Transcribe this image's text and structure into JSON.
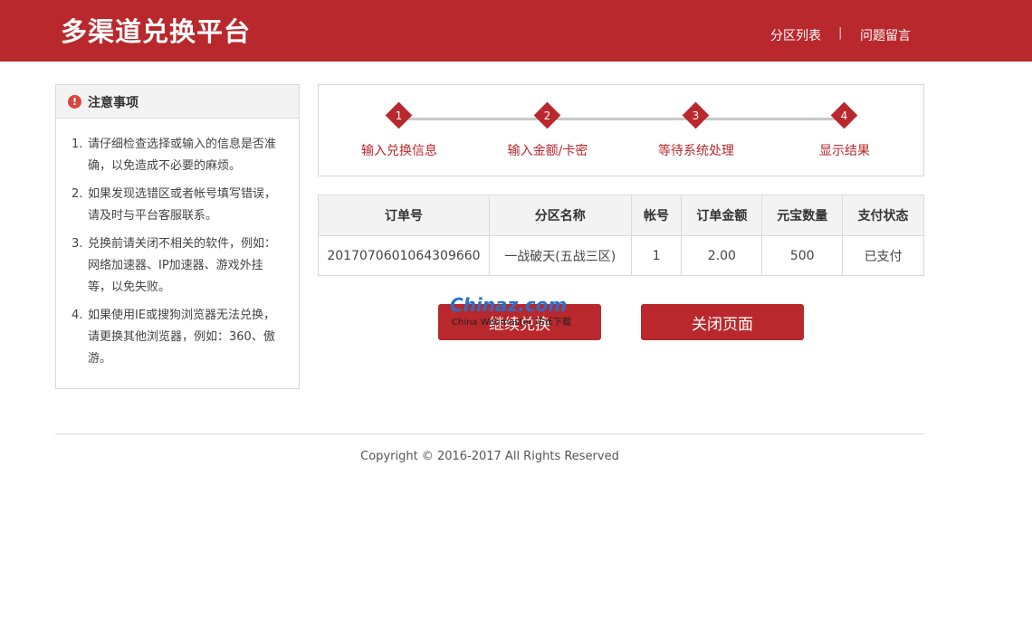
{
  "header": {
    "logo": "多渠道兑换平台",
    "nav": [
      "分区列表",
      "问题留言"
    ],
    "separator": "|"
  },
  "notice": {
    "icon": "alert-icon",
    "title": "注意事项",
    "items": [
      {
        "num": "1.",
        "text": "请仔细检查选择或输入的信息是否准确，以免造成不必要的麻烦。"
      },
      {
        "num": "2.",
        "text": "如果发现选错区或者帐号填写错误，请及时与平台客服联系。"
      },
      {
        "num": "3.",
        "text": "兑换前请关闭不相关的软件，例如：网络加速器、IP加速器、游戏外挂等，以免失败。"
      },
      {
        "num": "4.",
        "text": "如果使用IE或搜狗浏览器无法兑换，请更换其他浏览器，例如：360、傲游。"
      }
    ]
  },
  "steps": [
    {
      "num": "1",
      "label": "输入兑换信息"
    },
    {
      "num": "2",
      "label": "输入金额/卡密"
    },
    {
      "num": "3",
      "label": "等待系统处理"
    },
    {
      "num": "4",
      "label": "显示结果"
    }
  ],
  "orders": {
    "columns": [
      "订单号",
      "分区名称",
      "帐号",
      "订单金额",
      "元宝数量",
      "支付状态"
    ],
    "rows": [
      [
        "2017070601064309660",
        "一战破天(五战三区)",
        "1",
        "2.00",
        "500",
        "已支付"
      ]
    ]
  },
  "buttons": {
    "continue": "继续兑换",
    "close": "关闭页面"
  },
  "watermark": {
    "main": "Chinaz.com",
    "sub": "China Webmaster 站长下载"
  },
  "footer": {
    "copyright": "Copyright © 2016-2017 All Rights Reserved"
  },
  "colors": {
    "brand": "#b8282c",
    "border": "#d9d9d9",
    "header_bg": "#f3f3f3"
  }
}
